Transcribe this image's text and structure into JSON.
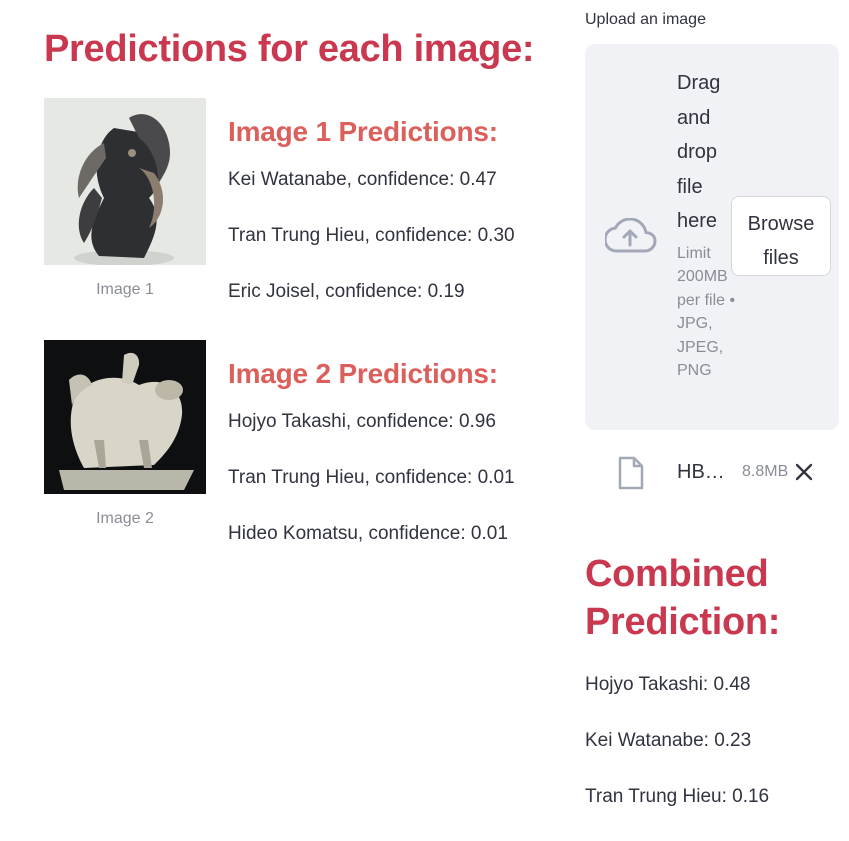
{
  "main": {
    "title": "Predictions for each image:",
    "images": [
      {
        "caption": "Image 1",
        "pred_title": "Image 1 Predictions:",
        "predictions": [
          "Kei Watanabe, confidence: 0.47",
          "Tran Trung Hieu, confidence: 0.30",
          "Eric Joisel, confidence: 0.19"
        ]
      },
      {
        "caption": "Image 2",
        "pred_title": "Image 2 Predictions:",
        "predictions": [
          "Hojyo Takashi, confidence: 0.96",
          "Tran Trung Hieu, confidence: 0.01",
          "Hideo Komatsu, confidence: 0.01"
        ]
      }
    ]
  },
  "uploader": {
    "label": "Upload an image",
    "drag_text": "Drag and drop file here",
    "limit_text": "Limit 200MB per file • JPG, JPEG, PNG",
    "browse_label": "Browse files",
    "icon": "cloud-upload-icon",
    "file": {
      "name": "HB…",
      "size": "8.8MB",
      "icon": "file-icon",
      "close_icon": "close-icon"
    }
  },
  "combined": {
    "title": "Combined Prediction:",
    "lines": [
      "Hojyo Takashi: 0.48",
      "Kei Watanabe: 0.23",
      "Tran Trung Hieu: 0.16"
    ]
  },
  "colors": {
    "heading": "#c9384f",
    "subheading": "#dc5f5b",
    "text": "#31333f",
    "muted": "#8a8d96",
    "dropzone_bg": "#f0f2f6"
  }
}
